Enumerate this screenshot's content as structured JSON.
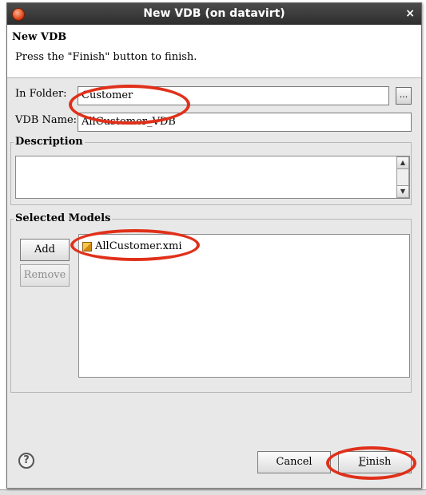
{
  "window": {
    "title": "New VDB  (on datavirt)",
    "close_glyph": "×",
    "app_icon": "eclipse-icon"
  },
  "header": {
    "title": "New VDB",
    "message": "Press the \"Finish\" button to finish."
  },
  "form": {
    "folder_label": "In Folder:",
    "folder_value": "Customer",
    "browse_label": "...",
    "name_label": "VDB Name:",
    "name_value": "AllCustomer_VDB"
  },
  "description": {
    "title": "Description",
    "value": ""
  },
  "models": {
    "title": "Selected Models",
    "add_label": "Add",
    "remove_label": "Remove",
    "items": [
      {
        "label": "AllCustomer.xmi",
        "icon": "model-cube-icon"
      }
    ]
  },
  "footer": {
    "help_glyph": "?",
    "cancel_label": "Cancel",
    "finish_label": "Finish",
    "finish_mnemonic": "F",
    "finish_rest": "inish"
  },
  "annotations": {
    "color": "#e0301a",
    "highlighted": [
      "folder-field",
      "model-list-item",
      "finish-button"
    ]
  }
}
